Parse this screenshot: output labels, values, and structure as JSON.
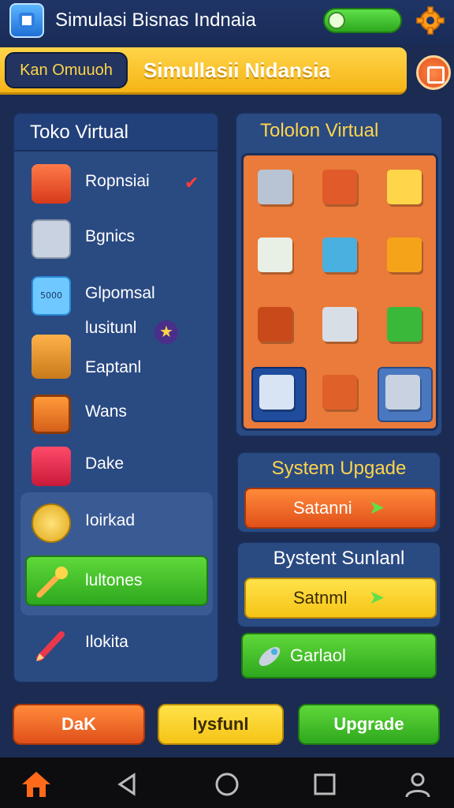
{
  "header": {
    "app_title": "Simulasi Bisnas Indnaia",
    "toggle_state": "on",
    "icons": {
      "app": "app-cube-icon",
      "settings": "gear-icon"
    }
  },
  "banner": {
    "chip_label": "Kan Omuuoh",
    "title": "Simullasii Nidansia",
    "icon": "box-icon"
  },
  "left_panel": {
    "title": "Toko Virtual",
    "items": [
      {
        "label": "Ropnsiai",
        "icon": "shop-icon",
        "badge": "✔"
      },
      {
        "label": "Bgnics",
        "icon": "cart-icon"
      },
      {
        "label": "Glpomsal",
        "icon": "banknote-icon",
        "icon_text": "5000"
      },
      {
        "label": "lusitunl",
        "icon": "tools-icon",
        "badge": "★"
      },
      {
        "label": "Eaptanl",
        "icon": "tools-icon"
      },
      {
        "label": "Wans",
        "icon": "tablet-icon"
      },
      {
        "label": "Dake",
        "icon": "truck-icon"
      },
      {
        "label": "Ioirkad",
        "icon": "coin-icon"
      },
      {
        "label": "lultones",
        "icon": "wrench-icon"
      },
      {
        "label": "Ilokita",
        "icon": "pen-icon"
      }
    ]
  },
  "right_panel": {
    "title": "Tololon Virtual",
    "grid_icons": [
      "register-icon",
      "parcel-icon",
      "shop-stall-icon",
      "cash-bundle-icon",
      "shopping-cart-icon",
      "boxes-icon",
      "crate-icon",
      "shelf-icon",
      "money-box-icon",
      "basket-icon",
      "produce-crate-icon",
      "trolley-icon"
    ]
  },
  "cards": [
    {
      "title": "System Upgade",
      "button_label": "Satanni"
    },
    {
      "title": "Bystent Sunlanl",
      "button_label": "Satnml"
    }
  ],
  "extra_button": {
    "label": "Garlaol",
    "icon": "rocket-icon"
  },
  "actions": {
    "left_label": "DaK",
    "middle_label": "lysfunl",
    "right_label": "Upgrade"
  },
  "navbar": {
    "icons": [
      "home-icon",
      "back-icon",
      "circle-home-icon",
      "recents-icon",
      "profile-icon"
    ]
  },
  "colors": {
    "background": "#1b2b52",
    "accent_yellow": "#ffd54a",
    "accent_orange": "#e0501a",
    "accent_green": "#2ea81e"
  }
}
